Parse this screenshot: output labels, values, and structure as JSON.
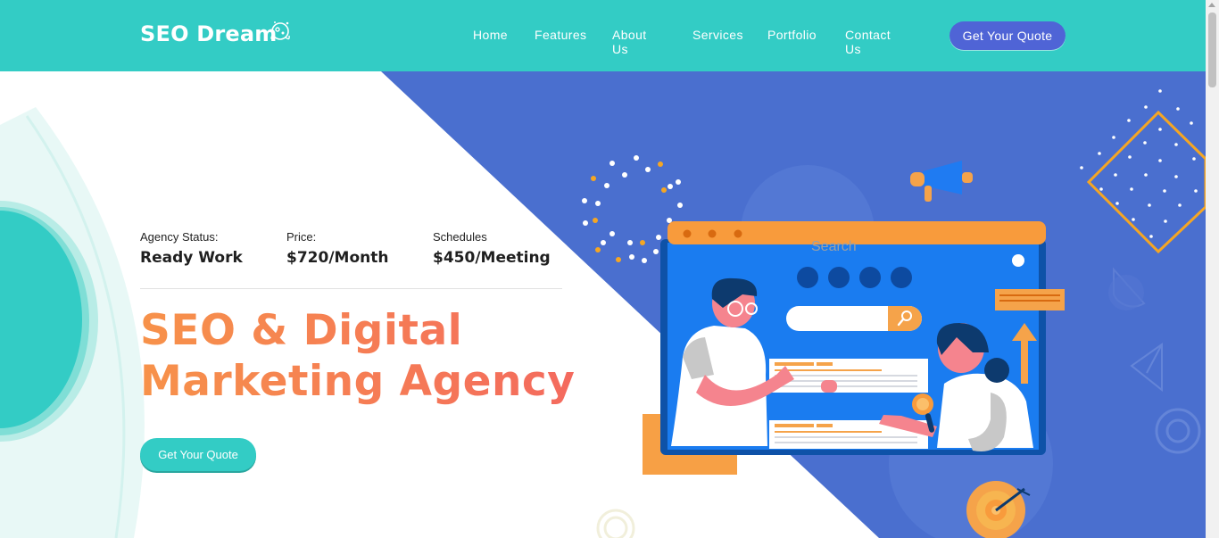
{
  "brand": {
    "name": "SEO Dream",
    "icon": "astronaut-icon"
  },
  "nav": {
    "items": [
      {
        "label": "Home"
      },
      {
        "label": "Features"
      },
      {
        "label": "About Us"
      },
      {
        "label": "Services"
      },
      {
        "label": "Portfolio"
      },
      {
        "label": "Contact Us"
      }
    ],
    "quote_button": "Get Your Quote"
  },
  "hero": {
    "stats": [
      {
        "label": "Agency Status:",
        "value": "Ready Work"
      },
      {
        "label": "Price:",
        "value": "$720/Month"
      },
      {
        "label": "Schedules",
        "value": "$450/Meeting"
      }
    ],
    "headline_line1": "SEO & Digital",
    "headline_line2": "Marketing Agency",
    "cta": "Get Your Quote"
  },
  "illustration": {
    "search_placeholder": "Search",
    "icons": [
      "megaphone-icon",
      "magnifier-icon",
      "target-icon",
      "arrow-up-icon",
      "paper-plane-icon"
    ]
  },
  "colors": {
    "header": "#33ccc5",
    "accent_blue": "#4f64d6",
    "hero_blue": "#4a6fcf",
    "headline_orange": "#f7924a",
    "headline_red": "#f46a5e"
  }
}
